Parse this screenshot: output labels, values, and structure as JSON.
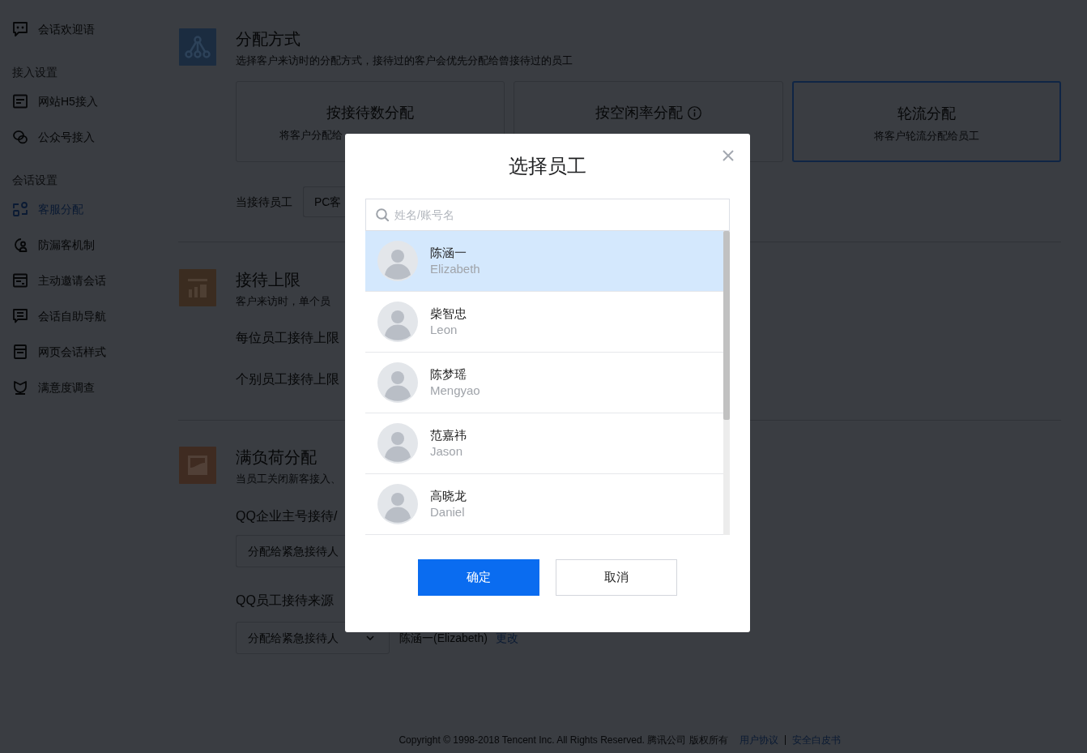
{
  "sidebar": {
    "groups": [
      {
        "items": [
          {
            "label": "会话欢迎语",
            "selected": false
          }
        ]
      },
      {
        "heading": "接入设置",
        "items": [
          {
            "label": "网站H5接入",
            "selected": false
          },
          {
            "label": "公众号接入",
            "selected": false
          }
        ]
      },
      {
        "heading": "会话设置",
        "items": [
          {
            "label": "客服分配",
            "selected": true
          },
          {
            "label": "防漏客机制",
            "selected": false
          },
          {
            "label": "主动邀请会话",
            "selected": false
          },
          {
            "label": "会话自助导航",
            "selected": false
          },
          {
            "label": "网页会话样式",
            "selected": false
          },
          {
            "label": "满意度调查",
            "selected": false
          }
        ]
      }
    ]
  },
  "sections": [
    {
      "title": "分配方式",
      "description": "选择客户来访时的分配方式，接待过的客户会优先分配给曾接待过的员工",
      "color": "#1b2c40",
      "options": [
        {
          "title": "按接待数分配",
          "description": "将客户分配给",
          "info": false,
          "selected": false
        },
        {
          "title": "按空闲率分配",
          "info": true,
          "selected": false
        },
        {
          "title": "轮流分配",
          "description": "将客户轮流分配给员工",
          "info": false,
          "selected": true
        }
      ],
      "fields": [
        {
          "kind": "inline-select",
          "label": "当接待员工",
          "select": "PC客"
        }
      ]
    },
    {
      "title": "接待上限",
      "description": "客户来访时，单个员",
      "color": "#3b2c20",
      "fields": [
        {
          "kind": "label",
          "label": "每位员工接待上限"
        },
        {
          "kind": "label",
          "label": "个别员工接待上限"
        }
      ]
    },
    {
      "title": "满负荷分配",
      "description": "当员工关闭新客接入、",
      "color": "#3f2b21",
      "fields": [
        {
          "kind": "stacked-select",
          "label": "QQ企业主号接待/",
          "select": "分配给紧急接待人"
        },
        {
          "kind": "stacked-select",
          "label": "QQ员工接待来源",
          "select": "分配给紧急接待人",
          "value": "陈涵一(Elizabeth)",
          "link": "更改"
        }
      ]
    }
  ],
  "footer": {
    "copyright": "Copyright © 1998-2018 Tencent Inc. All Rights Reserved. 腾讯公司 版权所有",
    "links": [
      "用户协议",
      "安全白皮书"
    ]
  },
  "dialog": {
    "title": "选择员工",
    "search": {
      "placeholder": "姓名/账号名"
    },
    "employees": [
      {
        "name": "陈涵一",
        "account": "Elizabeth",
        "selected": true
      },
      {
        "name": "柴智忠",
        "account": "Leon",
        "selected": false
      },
      {
        "name": "陈梦瑶",
        "account": "Mengyao",
        "selected": false
      },
      {
        "name": "范嘉祎",
        "account": "Jason",
        "selected": false
      },
      {
        "name": "高晓龙",
        "account": "Daniel",
        "selected": false
      }
    ],
    "buttons": [
      {
        "label": "确定",
        "kind": "primary"
      },
      {
        "label": "取消",
        "kind": "secondary"
      }
    ]
  }
}
